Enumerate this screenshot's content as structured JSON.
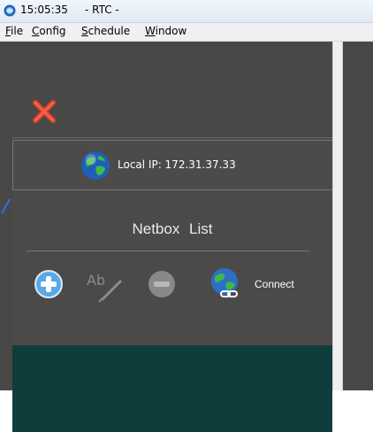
{
  "window": {
    "time": "15:05:35",
    "title": "- RTC -"
  },
  "menu": {
    "items": [
      {
        "accel": "F",
        "rest": "ile"
      },
      {
        "accel": "C",
        "rest": "onfig"
      },
      {
        "accel": "S",
        "rest": "chedule"
      },
      {
        "accel": "W",
        "rest": "indow"
      }
    ]
  },
  "sidebar": {
    "close_icon": "close-icon",
    "local_ip": "Local IP: 172.31.37.33",
    "netbox_list_title": "Netbox  List",
    "toolbar": {
      "add_icon": "add-icon",
      "rename_icon": "rename-icon",
      "remove_icon": "remove-icon",
      "connect_label": "Connect"
    }
  },
  "colors": {
    "panel_bg": "#4c4949",
    "teal_panel": "#0e3d3c",
    "close_red": "#e2432b",
    "add_blue": "#5aa9e6"
  }
}
